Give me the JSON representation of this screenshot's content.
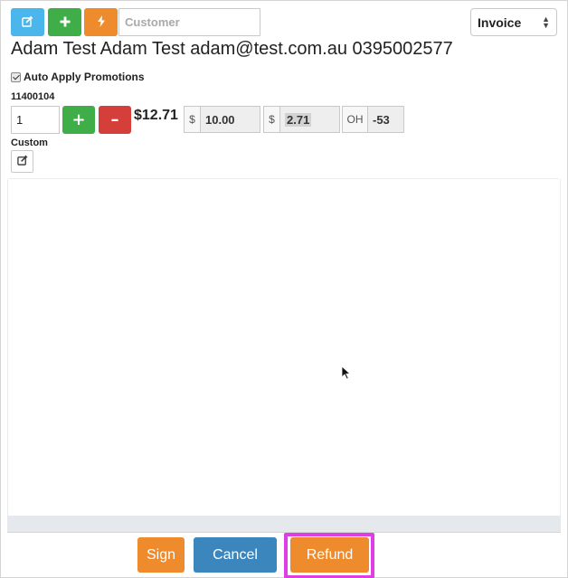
{
  "toolbar": {
    "edit_button_icon": "edit-icon",
    "add_button_icon": "plus-icon",
    "quick_button_icon": "lightning-icon",
    "customer_placeholder": "Customer",
    "customer_value": "",
    "doc_type_selected": "Invoice"
  },
  "customer": {
    "details": "Adam Test Adam Test adam@test.com.au 0395002577"
  },
  "promotions": {
    "label": "Auto Apply Promotions",
    "checked": true
  },
  "item": {
    "sku": "11400104",
    "quantity": "1",
    "plus_label": "+",
    "minus_label": "–",
    "total_price": "$12.71",
    "unit_price_prefix": "$",
    "unit_price": "10.00",
    "tax_prefix": "$",
    "tax": "2.71",
    "on_hand_prefix": "OH",
    "on_hand": "-53"
  },
  "custom": {
    "label": "Custom",
    "edit_icon": "edit-icon"
  },
  "footer": {
    "sign_label": "Sign",
    "cancel_label": "Cancel",
    "refund_label": "Refund"
  },
  "colors": {
    "info_blue": "#4ab6ec",
    "success_green": "#3fae49",
    "warning_orange": "#ee8b2d",
    "danger_red": "#d43f3a",
    "primary_blue": "#3a86bd",
    "highlight_magenta": "#e03ee5"
  }
}
